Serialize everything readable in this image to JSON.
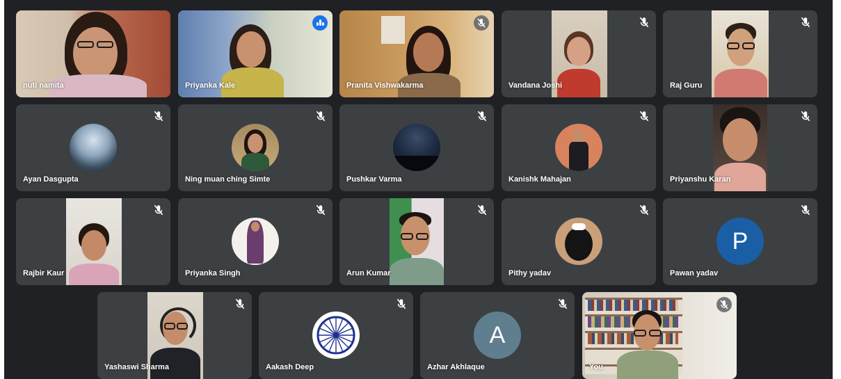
{
  "participants": [
    {
      "name": "nuti namita",
      "muted": false
    },
    {
      "name": "Priyanka Kale",
      "speaking": true
    },
    {
      "name": "Pranita Vishwakarma",
      "muted": true
    },
    {
      "name": "Vandana Joshi",
      "muted": true
    },
    {
      "name": "Raj Guru",
      "muted": true
    },
    {
      "name": "Ayan Dasgupta",
      "muted": true
    },
    {
      "name": "Ning muan ching Simte",
      "muted": true
    },
    {
      "name": "Pushkar Varma",
      "muted": true
    },
    {
      "name": "Kanishk Mahajan",
      "muted": true
    },
    {
      "name": "Priyanshu Karan",
      "muted": true
    },
    {
      "name": "Rajbir Kaur",
      "muted": true
    },
    {
      "name": "Priyanka Singh",
      "muted": true
    },
    {
      "name": "Arun Kumar",
      "muted": true
    },
    {
      "name": "Pithy yadav",
      "muted": true
    },
    {
      "name": "Pawan yadav",
      "muted": true,
      "initial": "P",
      "avatar_color": "#1a5fa6"
    },
    {
      "name": "Yashaswi Sharma",
      "muted": true
    },
    {
      "name": "Aakash Deep",
      "muted": true
    },
    {
      "name": "Azhar Akhlaque",
      "muted": true,
      "initial": "A",
      "avatar_color": "#5f7f8f"
    },
    {
      "name": "You",
      "muted": true
    }
  ],
  "icons": {
    "mute": "mic-off-icon",
    "speaking": "audio-level-icon"
  },
  "colors": {
    "stage": "#202124",
    "tile": "#3c4043",
    "speaking_border": "#8ab4f8"
  }
}
